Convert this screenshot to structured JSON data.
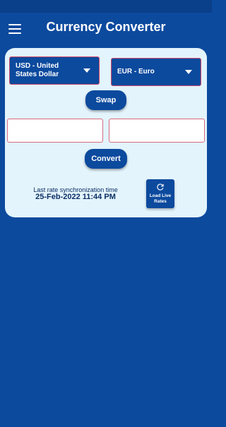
{
  "app_bar": {
    "title": "Currency Converter",
    "menu_icon": "menu-icon"
  },
  "converter": {
    "from_currency": "USD - United States Dollar",
    "to_currency": "EUR - Euro",
    "swap_label": "Swap",
    "convert_label": "Convert",
    "from_amount": "",
    "to_amount": ""
  },
  "sync": {
    "label": "Last rate synchronization time",
    "value": "25-Feb-2022 11:44 PM"
  },
  "live_rates": {
    "label": "Load Live Rates",
    "icon": "refresh-icon"
  },
  "colors": {
    "primary": "#0c4a9e",
    "card_background": "#e3f4fd",
    "select_border": "#d04a6a",
    "text_dark": "#0b2e63"
  }
}
